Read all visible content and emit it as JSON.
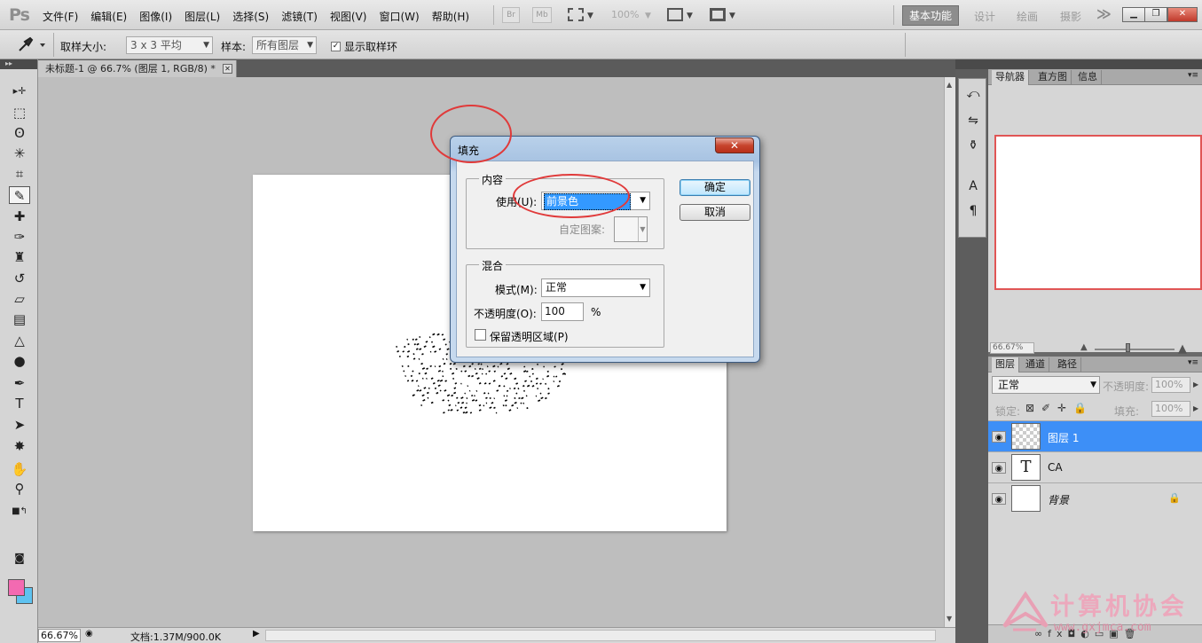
{
  "app": {
    "logo": "Ps",
    "menu": [
      "文件(F)",
      "编辑(E)",
      "图像(I)",
      "图层(L)",
      "选择(S)",
      "滤镜(T)",
      "视图(V)",
      "窗口(W)",
      "帮助(H)"
    ],
    "bridge_btn": "Br",
    "minibridge_btn": "Mb",
    "zoom_level": "100%",
    "workspaces": {
      "active": "基本功能",
      "design": "设计",
      "painting": "绘画",
      "photography": "摄影",
      "more": "≫"
    },
    "window_controls": {
      "minimize": "▁",
      "restore": "❐",
      "close": "✕"
    }
  },
  "options_bar": {
    "sample_size_label": "取样大小:",
    "sample_size_value": "3 x 3 平均",
    "sample_label": "样本:",
    "sample_value": "所有图层",
    "show_ring_label": "显示取样环",
    "show_ring_checked": "✓"
  },
  "document": {
    "tab_title": "未标题-1 @ 66.7% (图层 1, RGB/8) *",
    "tab_close": "✕",
    "status_zoom": "66.67%",
    "status_doc": "文档:1.37M/900.0K"
  },
  "toolbox": {
    "tools": [
      {
        "icon": "move-icon",
        "glyph": "▸✛"
      },
      {
        "icon": "marquee-icon",
        "glyph": "⬚"
      },
      {
        "icon": "lasso-icon",
        "glyph": "ʘ"
      },
      {
        "icon": "quick-select-icon",
        "glyph": "✳"
      },
      {
        "icon": "crop-icon",
        "glyph": "⌗"
      },
      {
        "icon": "eyedropper-icon",
        "glyph": "✎"
      },
      {
        "icon": "healing-icon",
        "glyph": "✚"
      },
      {
        "icon": "brush-icon",
        "glyph": "✑"
      },
      {
        "icon": "stamp-icon",
        "glyph": "♜"
      },
      {
        "icon": "history-brush-icon",
        "glyph": "↺"
      },
      {
        "icon": "eraser-icon",
        "glyph": "▱"
      },
      {
        "icon": "gradient-icon",
        "glyph": "▤"
      },
      {
        "icon": "blur-icon",
        "glyph": "△"
      },
      {
        "icon": "dodge-icon",
        "glyph": "●"
      },
      {
        "icon": "pen-icon",
        "glyph": "✒"
      },
      {
        "icon": "type-icon",
        "glyph": "T"
      },
      {
        "icon": "path-select-icon",
        "glyph": "➤"
      },
      {
        "icon": "shape-icon",
        "glyph": "✸"
      },
      {
        "icon": "hand-icon",
        "glyph": "✋"
      },
      {
        "icon": "zoom-icon",
        "glyph": "⚲"
      }
    ],
    "foreground_color": "#f36ab1",
    "background_color": "#5ec2f0"
  },
  "navigator": {
    "tabs": [
      "导航器",
      "直方图",
      "信息"
    ],
    "zoom": "66.67%"
  },
  "layers": {
    "tabs": [
      "图层",
      "通道",
      "路径"
    ],
    "blend_mode": "正常",
    "opacity_label": "不透明度:",
    "opacity_value": "100%",
    "lock_label": "锁定:",
    "fill_label": "填充:",
    "fill_value": "100%",
    "items": [
      {
        "name": "图层 1",
        "selected": true,
        "thumb": "transparent"
      },
      {
        "name": "CA",
        "selected": false,
        "thumb": "T"
      },
      {
        "name": "背景",
        "selected": false,
        "thumb": "white",
        "locked": true
      }
    ]
  },
  "dialog": {
    "title": "填充",
    "close_glyph": "✕",
    "content_group": "内容",
    "use_label": "使用(U):",
    "use_value": "前景色",
    "custom_pattern_label": "自定图案:",
    "blend_group": "混合",
    "mode_label": "模式(M):",
    "mode_value": "正常",
    "opacity_label": "不透明度(O):",
    "opacity_value": "100",
    "opacity_unit": "%",
    "preserve_label": "保留透明区域(P)",
    "ok_button": "确定",
    "cancel_button": "取消"
  },
  "watermark": {
    "title": "计算机协会",
    "url": "www.gxjmca.com"
  }
}
